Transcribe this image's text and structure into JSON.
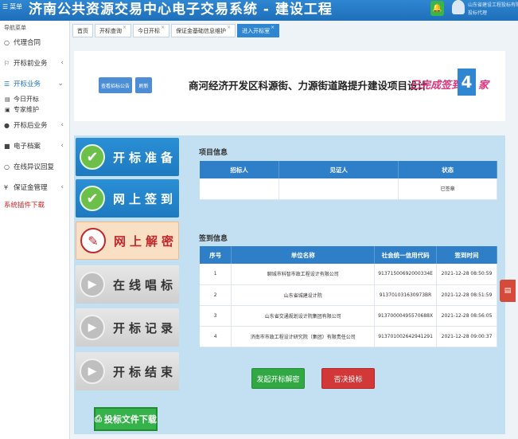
{
  "header": {
    "menu_label": "菜单",
    "title": "济南公共资源交易中心电子交易系统 - 建设工程",
    "user_name": "山东省建设工程投标有限公司",
    "user_role": "投标代理"
  },
  "sidebar": {
    "heading": "导航菜单",
    "items": [
      {
        "label": "代理合同",
        "icon": "circle-icon"
      },
      {
        "label": "开标前业务",
        "icon": "flag-icon"
      },
      {
        "label": "开标业务",
        "icon": "list-icon"
      },
      {
        "label": "今日开标",
        "icon": "calendar-icon"
      },
      {
        "label": "专家维护",
        "icon": "person-icon"
      },
      {
        "label": "开标后业务",
        "icon": "info-icon"
      },
      {
        "label": "电子档案",
        "icon": "folder-icon"
      },
      {
        "label": "在线异议回复",
        "icon": "circle-icon"
      },
      {
        "label": "保证金管理",
        "icon": "yen-icon"
      },
      {
        "label": "系统插件下载",
        "icon": ""
      }
    ]
  },
  "tabs": [
    {
      "label": "首页"
    },
    {
      "label": "开标查询"
    },
    {
      "label": "今日开标"
    },
    {
      "label": "保证金基础信息维护"
    },
    {
      "label": "进入开标室"
    }
  ],
  "banner": {
    "btn_1": "查看招标公告",
    "btn_2": "刷新",
    "project_title": "商河经济开发区科源街、力源街道路提升建设项目设计",
    "signed_text": "已完成签到",
    "signed_count": "4",
    "signed_unit": "家"
  },
  "steps": [
    {
      "label": "开标准备",
      "state": "done"
    },
    {
      "label": "网上签到",
      "state": "done"
    },
    {
      "label": "网上解密",
      "state": "current"
    },
    {
      "label": "在线唱标",
      "state": "todo"
    },
    {
      "label": "开标记录",
      "state": "todo"
    },
    {
      "label": "开标结束",
      "state": "todo"
    }
  ],
  "download_button": "投标文件下载",
  "project_info": {
    "title": "项目信息",
    "headers": [
      "招标人",
      "见证人",
      "状态"
    ],
    "row": [
      "",
      "",
      "已签章"
    ]
  },
  "sign_info": {
    "title": "签到信息",
    "headers": [
      "序号",
      "单位名称",
      "社会统一信用代码",
      "签到时间"
    ],
    "rows": [
      [
        "1",
        "聊城市科智市政工程设计有限公司",
        "91371500692000334E",
        "2021-12-28 08:50:59"
      ],
      [
        "2",
        "山东省城建设计院",
        "913701031630973BR",
        "2021-12-28 08:51:59"
      ],
      [
        "3",
        "山东省交通规划设计院集团有限公司",
        "91370000495570688X",
        "2021-12-28 08:56:05"
      ],
      [
        "4",
        "济南市市政工程设计研究院（集团）有限责任公司",
        "913701002642941291",
        "2021-12-28 09:00:37"
      ]
    ]
  },
  "actions": {
    "decrypt_button": "发起开标解密",
    "reject_button": "否决投标"
  },
  "colors": {
    "header_blue": "#2f86d1",
    "accent_pink": "#e0337a",
    "done_green": "#6cc04a",
    "current_red": "#c2282b"
  }
}
